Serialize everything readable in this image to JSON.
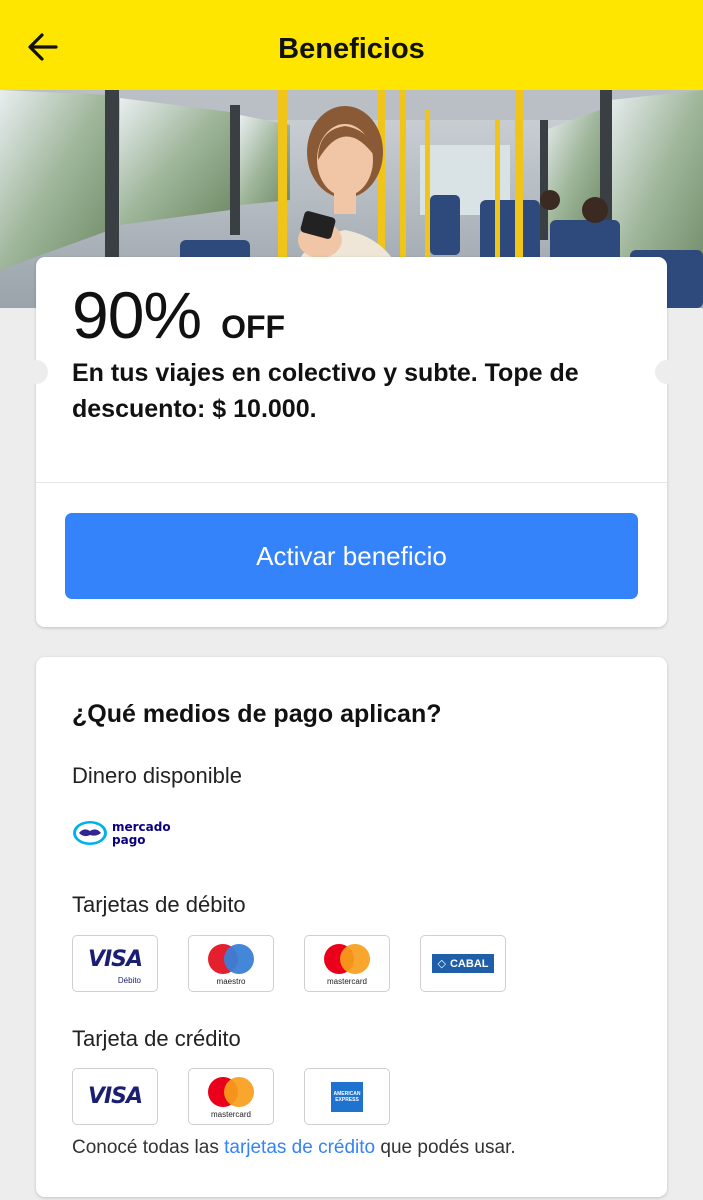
{
  "header": {
    "title": "Beneficios",
    "background_color": "#ffe600",
    "back_icon": "arrow-left-icon"
  },
  "hero": {
    "image_description_icon": "bus-passenger-photo"
  },
  "offer": {
    "percent": "90%",
    "off_label": "OFF",
    "description": "En tus viajes en colectivo y subte. Tope de descuento: $ 10.000.",
    "button_label": "Activar beneficio",
    "button_color": "#3483fa"
  },
  "payment": {
    "title": "¿Qué medios de pago aplican?",
    "available_money_label": "Dinero disponible",
    "mp_logo_line1": "mercado",
    "mp_logo_line2": "pago",
    "debit_label": "Tarjetas de débito",
    "debit_cards": [
      {
        "name": "VISA",
        "sub": "Débito"
      },
      {
        "name": "maestro"
      },
      {
        "name": "mastercard"
      },
      {
        "name": "CABAL"
      }
    ],
    "credit_label": "Tarjeta de crédito",
    "credit_cards": [
      {
        "name": "VISA"
      },
      {
        "name": "mastercard"
      },
      {
        "name": "AMERICAN EXPRESS"
      }
    ],
    "footer_prefix": "Conocé todas las ",
    "footer_link": "tarjetas de crédito",
    "footer_suffix": " que podés usar."
  }
}
